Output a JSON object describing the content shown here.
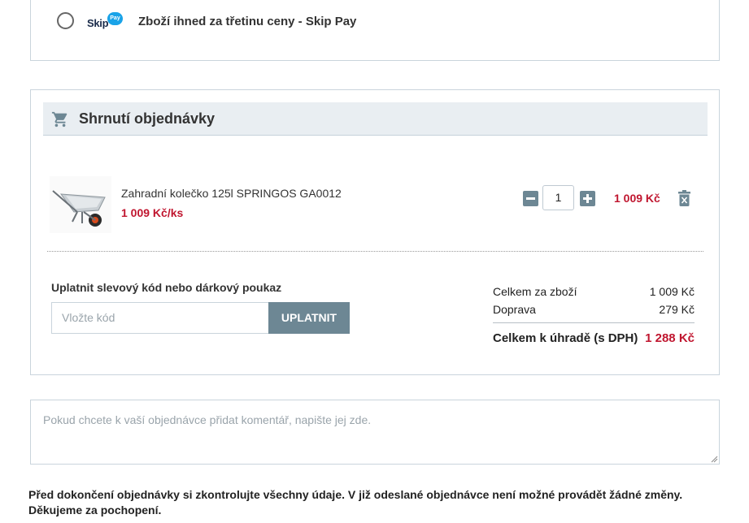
{
  "payment": {
    "logo_text": "Skip",
    "logo_bubble": "Pay",
    "option_label": "Zboží ihned za třetinu ceny - Skip Pay"
  },
  "summary": {
    "title": "Shrnutí objednávky",
    "icon": "cart-icon",
    "item": {
      "name": "Zahradní kolečko 125l SPRINGOS GA0012",
      "unit_price": "1 009 Kč/ks",
      "quantity": "1",
      "line_total": "1 009 Kč"
    },
    "coupon": {
      "label": "Uplatnit slevový kód nebo dárkový poukaz",
      "placeholder": "Vložte kód",
      "button": "UPLATNIT"
    },
    "totals": {
      "goods_label": "Celkem za zboží",
      "goods_value": "1 009 Kč",
      "shipping_label": "Doprava",
      "shipping_value": "279 Kč",
      "total_label": "Celkem k úhradě (s DPH)",
      "total_value": "1 288 Kč"
    }
  },
  "comment": {
    "placeholder": "Pokud chcete k vaší objednávce přidat komentář, napište jej zde."
  },
  "footer": {
    "line1": "Před dokončení objednávky si zkontrolujte všechny údaje. V již odeslané objednávce není možné provádět žádné změny.",
    "line2": "Děkujeme za pochopení."
  },
  "colors": {
    "accent": "#6d8794",
    "price": "#c0162f",
    "header_bg": "#e9eef2",
    "skip_blue": "#1aa3e8"
  }
}
